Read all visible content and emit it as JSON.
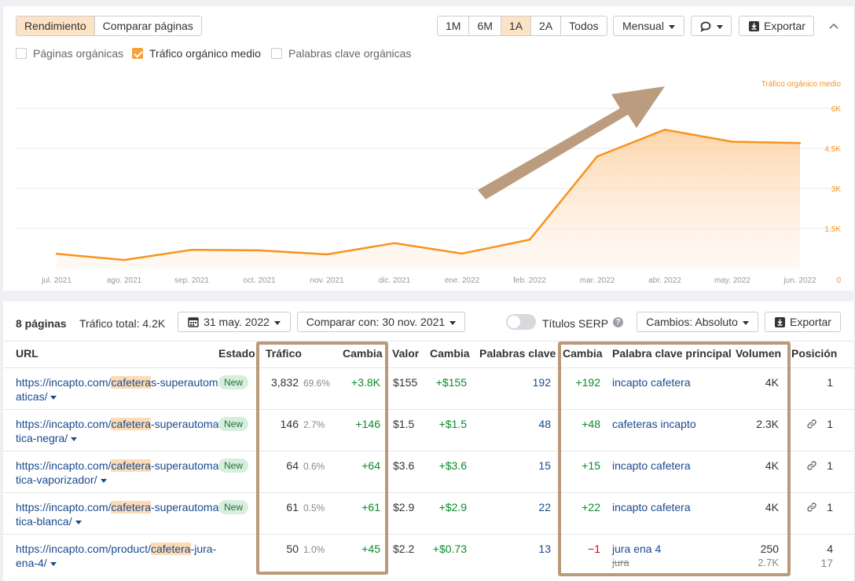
{
  "toolbar": {
    "view_tabs": [
      "Rendimiento",
      "Comparar páginas"
    ],
    "range_tabs": [
      "1M",
      "6M",
      "1A",
      "2A",
      "Todos"
    ],
    "period_select": "Mensual",
    "export_label": "Exportar"
  },
  "metrics": [
    {
      "label": "Páginas orgánicas",
      "checked": false
    },
    {
      "label": "Tráfico orgánico medio",
      "checked": true
    },
    {
      "label": "Palabras clave orgánicas",
      "checked": false
    }
  ],
  "chart_data": {
    "type": "area",
    "series": [
      {
        "name": "Tráfico orgánico medio",
        "values": [
          550,
          320,
          700,
          680,
          530,
          950,
          560,
          1080,
          4200,
          5200,
          4750,
          4700
        ]
      }
    ],
    "categories": [
      "jul. 2021",
      "ago. 2021",
      "sep. 2021",
      "oct. 2021",
      "nov. 2021",
      "dic. 2021",
      "ene. 2022",
      "feb. 2022",
      "mar. 2022",
      "abr. 2022",
      "may. 2022",
      "jun. 2022"
    ],
    "y_ticks": [
      "0",
      "1.5K",
      "3K",
      "4.5K",
      "6K"
    ],
    "y_tick_values": [
      0,
      1500,
      3000,
      4500,
      6000
    ],
    "ylim": [
      0,
      6000
    ],
    "legend": "top-right",
    "color": "#f7931e"
  },
  "summary": {
    "pages": "8 páginas",
    "total_traffic": "Tráfico total: 4.2K",
    "date": "31 may. 2022",
    "compare": "Comparar con: 30 nov. 2021",
    "serp_titles": "Títulos SERP",
    "changes": "Cambios: Absoluto",
    "export": "Exportar"
  },
  "columns": [
    "URL",
    "Estado",
    "Tráfico",
    "Cambia",
    "Valor",
    "Cambia",
    "Palabras clave",
    "Cambia",
    "Palabra clave principal",
    "Volumen",
    "Posición"
  ],
  "rows": [
    {
      "url_pre": "https://incapto.com/",
      "url_hl": "cafetera",
      "url_post": "s-superautomaticas/",
      "status": "New",
      "traffic": "3,832",
      "traffic_pct": "69.6%",
      "traffic_change": "+3.8K",
      "value": "$155",
      "value_change": "+$155",
      "keywords": "192",
      "kw_change": "+192",
      "kw_change_neg": false,
      "main_kw": "incapto cafetera",
      "main_kw2": "",
      "volume": "4K",
      "volume2": "",
      "link_icon": false,
      "position": "1",
      "position2": ""
    },
    {
      "url_pre": "https://incapto.com/",
      "url_hl": "cafetera",
      "url_post": "-superautomatica-negra/",
      "status": "New",
      "traffic": "146",
      "traffic_pct": "2.7%",
      "traffic_change": "+146",
      "value": "$1.5",
      "value_change": "+$1.5",
      "keywords": "48",
      "kw_change": "+48",
      "kw_change_neg": false,
      "main_kw": "cafeteras incapto",
      "main_kw2": "",
      "volume": "2.3K",
      "volume2": "",
      "link_icon": true,
      "position": "1",
      "position2": ""
    },
    {
      "url_pre": "https://incapto.com/",
      "url_hl": "cafetera",
      "url_post": "-superautomatica-vaporizador/",
      "status": "New",
      "traffic": "64",
      "traffic_pct": "0.6%",
      "traffic_change": "+64",
      "value": "$3.6",
      "value_change": "+$3.6",
      "keywords": "15",
      "kw_change": "+15",
      "kw_change_neg": false,
      "main_kw": "incapto cafetera",
      "main_kw2": "",
      "volume": "4K",
      "volume2": "",
      "link_icon": true,
      "position": "1",
      "position2": ""
    },
    {
      "url_pre": "https://incapto.com/",
      "url_hl": "cafetera",
      "url_post": "-superautomatica-blanca/",
      "status": "New",
      "traffic": "61",
      "traffic_pct": "0.5%",
      "traffic_change": "+61",
      "value": "$2.9",
      "value_change": "+$2.9",
      "keywords": "22",
      "kw_change": "+22",
      "kw_change_neg": false,
      "main_kw": "incapto cafetera",
      "main_kw2": "",
      "volume": "4K",
      "volume2": "",
      "link_icon": true,
      "position": "1",
      "position2": ""
    },
    {
      "url_pre": "https://incapto.com/product/",
      "url_hl": "cafetera",
      "url_post": "-jura-ena-4/",
      "status": "",
      "traffic": "50",
      "traffic_pct": "1.0%",
      "traffic_change": "+45",
      "value": "$2.2",
      "value_change": "+$0.73",
      "keywords": "13",
      "kw_change": "−1",
      "kw_change_neg": true,
      "main_kw": "jura ena 4",
      "main_kw2": "jura",
      "volume": "250",
      "volume2": "2.7K",
      "link_icon": false,
      "position": "4",
      "position2": "17"
    }
  ]
}
